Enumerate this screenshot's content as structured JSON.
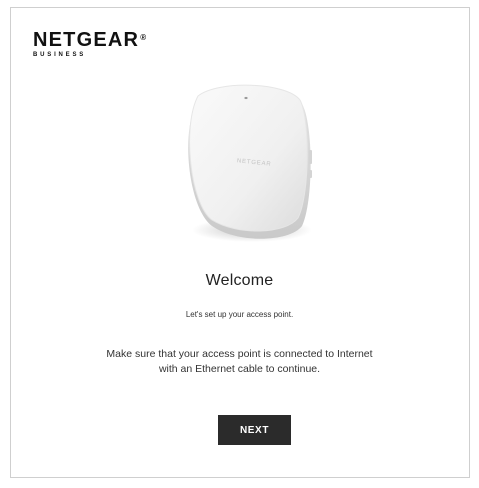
{
  "brand": {
    "name": "NETGEAR",
    "registered": "®",
    "sub": "BUSINESS",
    "device_logo": "NETGEAR"
  },
  "welcome": {
    "title": "Welcome",
    "subtitle": "Let's set up your access point.",
    "instructions_line1": "Make sure that your access point is connected to Internet",
    "instructions_line2": "with an Ethernet cable to continue.",
    "next_label": "NEXT"
  },
  "colors": {
    "button": "#2b2b2b",
    "button_text": "#ffffff",
    "border": "#cfcfcf"
  }
}
